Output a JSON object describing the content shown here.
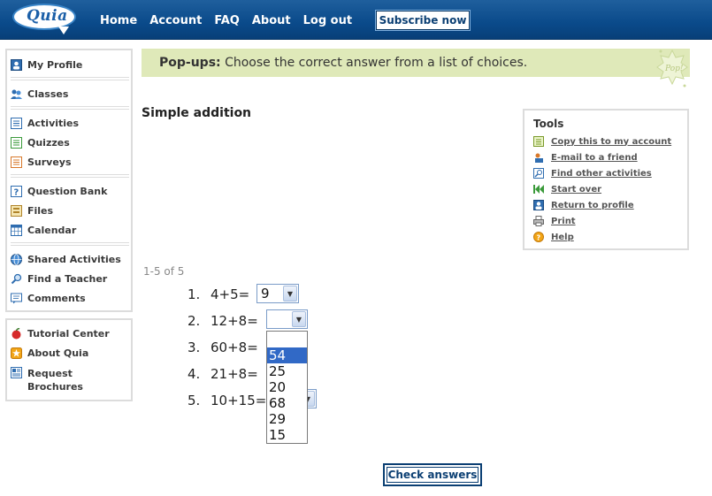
{
  "header": {
    "logo": "Quia",
    "nav": [
      "Home",
      "Account",
      "FAQ",
      "About",
      "Log out"
    ],
    "subscribe_label": "Subscribe now"
  },
  "sidebar": {
    "group1": [
      {
        "label": "My Profile",
        "icon": "profile-icon"
      }
    ],
    "group2": [
      {
        "label": "Classes",
        "icon": "classes-icon"
      }
    ],
    "group3": [
      {
        "label": "Activities",
        "icon": "activities-icon"
      },
      {
        "label": "Quizzes",
        "icon": "quizzes-icon"
      },
      {
        "label": "Surveys",
        "icon": "surveys-icon"
      }
    ],
    "group4": [
      {
        "label": "Question Bank",
        "icon": "question-bank-icon"
      },
      {
        "label": "Files",
        "icon": "files-icon"
      },
      {
        "label": "Calendar",
        "icon": "calendar-icon"
      }
    ],
    "group5": [
      {
        "label": "Shared Activities",
        "icon": "globe-icon"
      },
      {
        "label": "Find a Teacher",
        "icon": "magnifier-icon"
      },
      {
        "label": "Comments",
        "icon": "comments-icon"
      }
    ],
    "lower": [
      {
        "label": "Tutorial Center",
        "icon": "apple-icon"
      },
      {
        "label": "About Quia",
        "icon": "star-icon"
      },
      {
        "label": "Request Brochures",
        "icon": "brochure-icon"
      }
    ]
  },
  "banner": {
    "heading": "Pop-ups:",
    "instruction": "Choose the correct answer from a list of choices.",
    "badge_text": "Pop!"
  },
  "activity": {
    "title": "Simple addition",
    "pager": "1-5 of 5",
    "check_label": "Check answers",
    "questions": [
      {
        "num": "1.",
        "prompt": "4+5=",
        "selected": "9"
      },
      {
        "num": "2.",
        "prompt": "12+8=",
        "selected": ""
      },
      {
        "num": "3.",
        "prompt": "60+8=",
        "selected": ""
      },
      {
        "num": "4.",
        "prompt": "21+8=",
        "selected": ""
      },
      {
        "num": "5.",
        "prompt": "10+15=",
        "selected": ""
      }
    ],
    "open_dropdown": {
      "options": [
        "",
        "54",
        "25",
        "20",
        "68",
        "29",
        "15"
      ],
      "highlighted": "54"
    }
  },
  "tools": {
    "title": "Tools",
    "items": [
      {
        "label": "Copy this to my account",
        "icon": "copy-icon"
      },
      {
        "label": "E-mail to a friend",
        "icon": "email-icon"
      },
      {
        "label": "Find other activities",
        "icon": "find-icon"
      },
      {
        "label": "Start over",
        "icon": "rewind-icon"
      },
      {
        "label": "Return to profile",
        "icon": "profile-icon"
      },
      {
        "label": "Print",
        "icon": "print-icon"
      },
      {
        "label": "Help",
        "icon": "help-icon"
      }
    ]
  },
  "colors": {
    "header_blue": "#0a4a8a",
    "banner_green": "#dfe9b9",
    "highlight_blue": "#3169c6"
  }
}
